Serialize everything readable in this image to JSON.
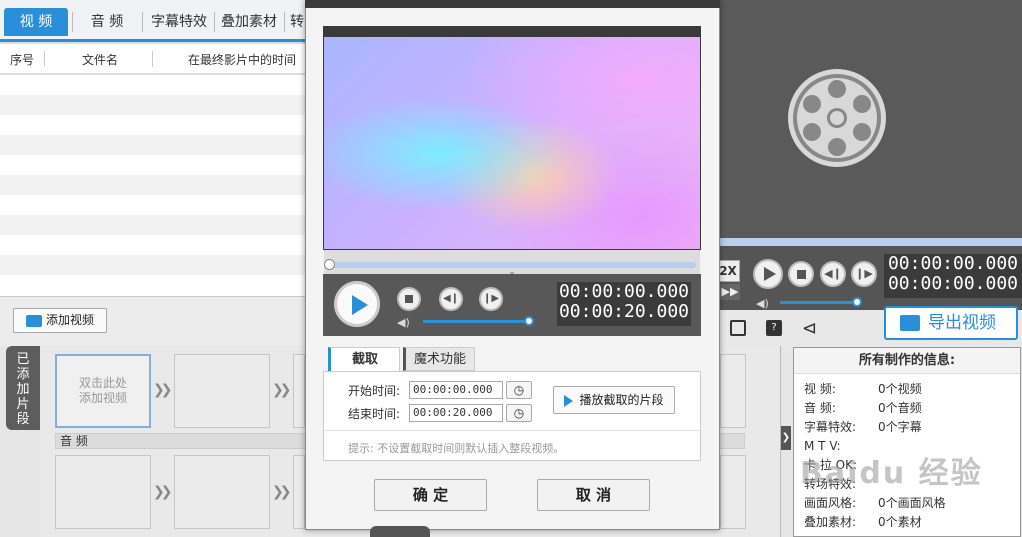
{
  "left_tabs": [
    "视  频",
    "音  频",
    "字幕特效",
    "叠加素材",
    "转"
  ],
  "list_columns": [
    "序号",
    "文件名",
    "在最终影片中的时间"
  ],
  "add_video_label": "添加视频",
  "added_clips_label": "已添加片段",
  "slot_hint": "双击此处\n添加视频",
  "audio_label": "音  频",
  "dialog": {
    "time_top": "00:00:00.000",
    "time_bottom": "00:00:20.000",
    "tab_cut": "截取",
    "tab_magic": "魔术功能",
    "start_label": "开始时间:",
    "start_value": "00:00:00.000",
    "end_label": "结束时间:",
    "end_value": "00:00:20.000",
    "play_clip_label": "播放截取的片段",
    "hint": "提示: 不设置截取时间则默认插入整段视频。",
    "ok_label": "确  定",
    "cancel_label": "取  消"
  },
  "right_preview": {
    "speed_label": "2X",
    "time_top": "00:00:00.000",
    "time_bottom": "00:00:00.000",
    "export_label": "导出视频"
  },
  "info": {
    "title": "所有制作的信息:",
    "rows": [
      {
        "label": "视    频:",
        "value": "0个视频"
      },
      {
        "label": "音    频:",
        "value": "0个音频"
      },
      {
        "label": "字幕特效:",
        "value": "0个字幕"
      },
      {
        "label": "M  T  V:",
        "value": ""
      },
      {
        "label": "卡 拉 OK:",
        "value": ""
      },
      {
        "label": "转场特效:",
        "value": ""
      },
      {
        "label": "画面风格:",
        "value": "0个画面风格"
      },
      {
        "label": "叠加素材:",
        "value": "0个素材"
      }
    ]
  },
  "watermark": "Baidu 经验",
  "colors": {
    "accent": "#2a8fd9",
    "dark": "#3b3b3b"
  }
}
